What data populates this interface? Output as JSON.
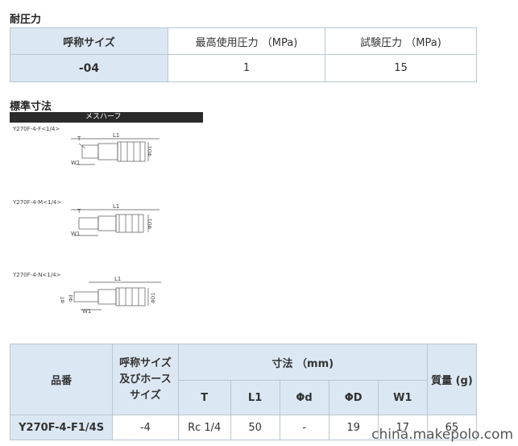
{
  "pressure": {
    "title": "耐圧力",
    "headers": [
      "呼称サイズ",
      "最高使用圧力 （MPa)",
      "試験圧力 （MPa)"
    ],
    "row": [
      "-04",
      "1",
      "15"
    ]
  },
  "dimensions": {
    "title": "標準寸法",
    "bar_label": "メスハーフ",
    "drawings": [
      {
        "caption": "Y270F-4-F<1/4>",
        "labels": [
          "T",
          "L1",
          "W1",
          "ΦD1"
        ]
      },
      {
        "caption": "Y270F-4-M<1/4>",
        "labels": [
          "T",
          "L1",
          "W1",
          "ΦD1"
        ]
      },
      {
        "caption": "Y270F-4-N<1/4>",
        "labels": [
          "ΦT",
          "L1",
          "W1",
          "Φd",
          "ΦD1"
        ]
      }
    ]
  },
  "spec_table": {
    "h_part": "品番",
    "h_size": "呼称サイズ 及びホース サイズ",
    "h_dims": "寸法 （mm)",
    "h_weight": "質量 (g)",
    "sub": [
      "T",
      "L1",
      "Φd",
      "ΦD",
      "W1"
    ],
    "row": [
      "Y270F-4-F1/4S",
      "-4",
      "Rc 1/4",
      "50",
      "-",
      "19",
      "17",
      "65"
    ]
  },
  "watermark": "china.makepolo.com"
}
